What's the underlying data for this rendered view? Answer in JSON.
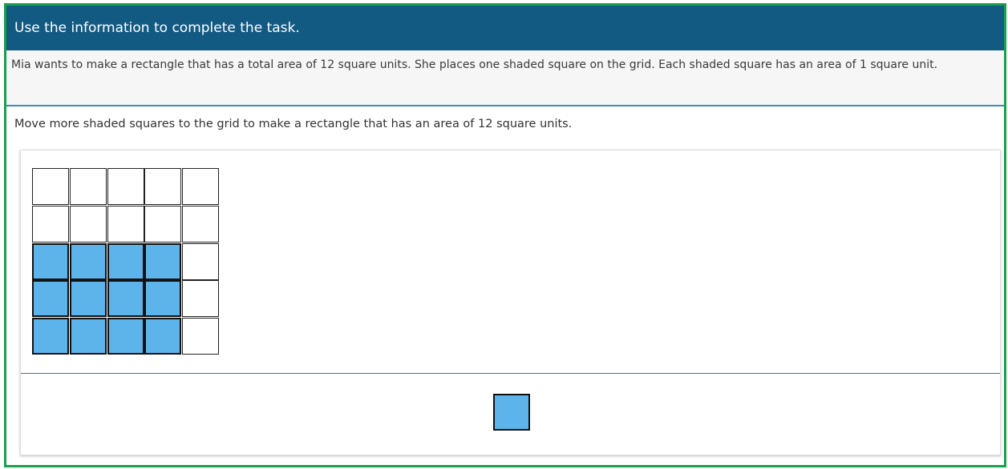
{
  "header": {
    "title": "Use the information to complete the task."
  },
  "stimulus": {
    "text": "Mia wants to make a rectangle that has a total area of 12 square units. She places one shaded square on the grid. Each shaded square has an area of 1 square unit."
  },
  "prompt": {
    "text": "Move more shaded squares to the grid to make a rectangle that has an area of 12 square units."
  },
  "grid": {
    "rows": 5,
    "cols": 5,
    "shaded_cells": [
      [
        2,
        0
      ],
      [
        2,
        1
      ],
      [
        2,
        2
      ],
      [
        2,
        3
      ],
      [
        3,
        0
      ],
      [
        3,
        1
      ],
      [
        3,
        2
      ],
      [
        3,
        3
      ],
      [
        4,
        0
      ],
      [
        4,
        1
      ],
      [
        4,
        2
      ],
      [
        4,
        3
      ]
    ]
  },
  "source": {
    "item": "shaded square"
  },
  "colors": {
    "header_background": "#135a83",
    "frame_border": "#19a04b",
    "shaded_fill": "#5db4ea",
    "divider": "#2f78b2"
  }
}
